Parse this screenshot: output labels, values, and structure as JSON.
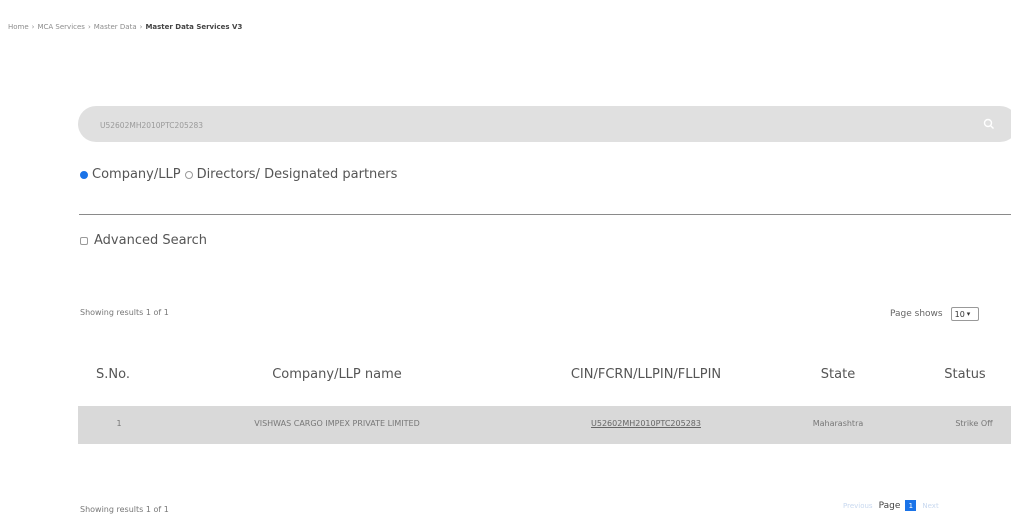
{
  "breadcrumb": {
    "items": [
      "Home",
      "MCA Services",
      "Master Data"
    ],
    "current": "Master Data Services V3",
    "separator": "›"
  },
  "search": {
    "value": "U52602MH2010PTC205283",
    "icon": "search-icon"
  },
  "entity_type": {
    "options": [
      {
        "label": "Company/LLP",
        "selected": true
      },
      {
        "label": "Directors/ Designated partners",
        "selected": false
      }
    ]
  },
  "advanced_search": {
    "label": "Advanced Search",
    "checked": false
  },
  "results": {
    "summary_top": "Showing results 1 of 1",
    "summary_bottom": "Showing results 1 of 1",
    "page_shows_label": "Page shows",
    "page_size": "10"
  },
  "table": {
    "headers": [
      "S.No.",
      "Company/LLP name",
      "CIN/FCRN/LLPIN/FLLPIN",
      "State",
      "Status"
    ],
    "rows": [
      [
        "1",
        "VISHWAS CARGO IMPEX PRIVATE LIMITED",
        "U52602MH2010PTC205283",
        "Maharashtra",
        "Strike Off"
      ]
    ]
  },
  "pagination": {
    "previous": "Previous",
    "page_label": "Page",
    "current_page": "1",
    "next": "Next"
  },
  "colors": {
    "accent": "#1a73e8",
    "search_bg": "#e0e0e0",
    "row_bg": "#d9d9d9"
  }
}
